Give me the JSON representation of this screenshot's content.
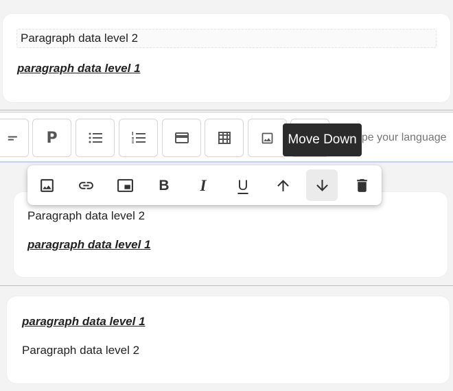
{
  "block1": {
    "para_level2": "Paragraph data level 2",
    "para_level1": "paragraph data level 1"
  },
  "toolbar": {
    "paragraph_glyph": "P",
    "language_placeholder": "Type your language",
    "icons": [
      "divider-icon",
      "paragraph-icon",
      "bullet-list-icon",
      "numbered-list-icon",
      "card-icon",
      "table-icon",
      "image-icon",
      "code-icon"
    ]
  },
  "tooltip": {
    "label": "Move Down"
  },
  "floating_toolbar": {
    "bold": "B",
    "italic": "I",
    "underline": "U",
    "active_button": "move-down-button",
    "icons": [
      "image-icon",
      "link-icon",
      "picture-in-picture-icon",
      "bold-icon",
      "italic-icon",
      "underline-icon",
      "arrow-up-icon",
      "arrow-down-icon",
      "trash-icon"
    ]
  },
  "block2": {
    "para_level2": "Paragraph data level 2",
    "para_level1": "paragraph data level 1"
  },
  "block3": {
    "para_level1": "paragraph data level 1",
    "para_level2": "Paragraph data level 2"
  },
  "colors": {
    "background": "#f3f3f3",
    "card": "#ffffff",
    "tooltip_bg": "#2b2b2b",
    "focus_border": "#bcd3f3",
    "active_button_bg": "#ebebeb"
  }
}
